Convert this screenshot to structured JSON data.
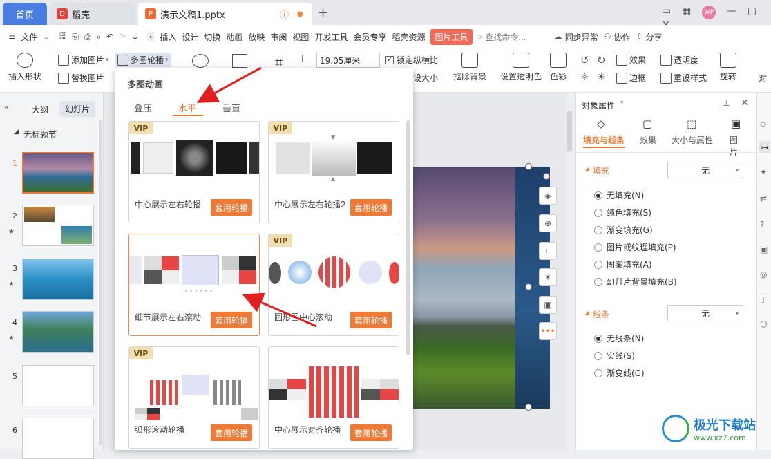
{
  "tabs": {
    "home": "首页",
    "docer": "稻壳",
    "document": "演示文稿1.pptx"
  },
  "menu": {
    "file": "文件",
    "items": [
      "插入",
      "设计",
      "切换",
      "动画",
      "放映",
      "审阅",
      "视图",
      "开发工具",
      "会员专享",
      "稻壳资源"
    ],
    "picture_tools": "图片工具",
    "search": "查找命令...",
    "sync": "同步异常",
    "collab": "协作",
    "share": "分享"
  },
  "ribbon": {
    "insert_shape": "插入形状",
    "add_picture": "添加图片",
    "replace_picture": "替换图片",
    "multi_carousel": "多图轮播",
    "width_value": "19.05厘米",
    "lock_ratio": "锁定纵横比",
    "resize": "设大小",
    "remove_bg": "抠除背景",
    "set_transparent": "设置透明色",
    "color": "色彩",
    "effect": "效果",
    "transparency": "透明度",
    "border": "边框",
    "reset_style": "重设样式",
    "rotate": "旋转",
    "align": "对"
  },
  "left_panel": {
    "outline": "大纲",
    "slides": "幻灯片",
    "section": "无标题节",
    "slide_numbers": [
      "1",
      "2",
      "3",
      "4",
      "5",
      "6"
    ]
  },
  "popup": {
    "title": "多图动画",
    "tabs": [
      "叠压",
      "水平",
      "垂直"
    ],
    "active_tab": "水平",
    "cards": [
      {
        "name": "中心展示左右轮播",
        "vip": true,
        "button": "套用轮播"
      },
      {
        "name": "中心展示左右轮播2",
        "vip": true,
        "button": "套用轮播"
      },
      {
        "name": "细节展示左右滚动",
        "vip": false,
        "button": "套用轮播"
      },
      {
        "name": "圆形图中心滚动",
        "vip": true,
        "button": "套用轮播"
      },
      {
        "name": "弧形滚动轮播",
        "vip": true,
        "button": "套用轮播"
      },
      {
        "name": "中心展示对齐轮播",
        "vip": false,
        "button": "套用轮播"
      }
    ],
    "vip_label": "VIP"
  },
  "right_panel": {
    "title": "对象属性",
    "tabs": [
      "填充与线条",
      "效果",
      "大小与属性",
      "图片"
    ],
    "fill_title": "填充",
    "fill_value": "无",
    "fill_options": [
      "无填充(N)",
      "纯色填充(S)",
      "渐变填充(G)",
      "图片或纹理填充(P)",
      "图案填充(A)",
      "幻灯片背景填充(B)"
    ],
    "line_title": "线条",
    "line_value": "无",
    "line_options": [
      "无线条(N)",
      "实线(S)",
      "渐变线(G)"
    ]
  },
  "watermark": {
    "name": "极光下载站",
    "url": "www.xz7.com"
  },
  "colors": {
    "accent": "#ef7a35",
    "home_tab": "#4a7de0",
    "picture_tools": "#f06a5a"
  }
}
